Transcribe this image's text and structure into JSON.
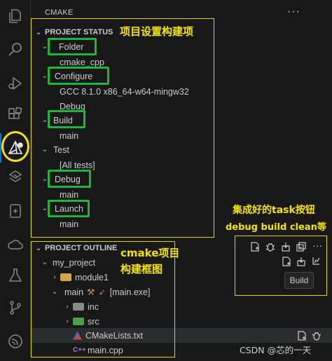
{
  "explorer": {
    "title": "CMAKE",
    "more_icon": "ellipsis-icon"
  },
  "project_status": {
    "header": "PROJECT STATUS",
    "folder_label": "Folder",
    "folder_value": "cmake_cpp",
    "configure_label": "Configure",
    "configure_kit": "GCC 8.1.0 x86_64-w64-mingw32",
    "configure_type": "Debug",
    "build_label": "Build",
    "build_target": "main",
    "test_label": "Test",
    "test_value": "[All tests]",
    "debug_label": "Debug",
    "debug_target": "main",
    "launch_label": "Launch",
    "launch_target": "main"
  },
  "project_outline": {
    "header": "PROJECT OUTLINE",
    "project": "my_project",
    "module": "module1",
    "main_target": "main",
    "main_exe": "[main.exe]",
    "inc": "inc",
    "src": "src",
    "cmakelists": "CMakeLists.txt",
    "main_cpp": "main.cpp"
  },
  "annotations": {
    "status_note": "项目设置构建项",
    "task_note_line1": "集成好的task按钮",
    "task_note_line2": "debug build clean等",
    "outline_note_line1": "cmake项目",
    "outline_note_line2": "构建框图"
  },
  "tooltip": "Build",
  "watermark": "CSDN @芯的一天",
  "colors": {
    "accent_blue": "#0078d4",
    "highlight_green": "#1fb53a",
    "annotation_yellow": "#f5e400",
    "background": "#181818"
  }
}
